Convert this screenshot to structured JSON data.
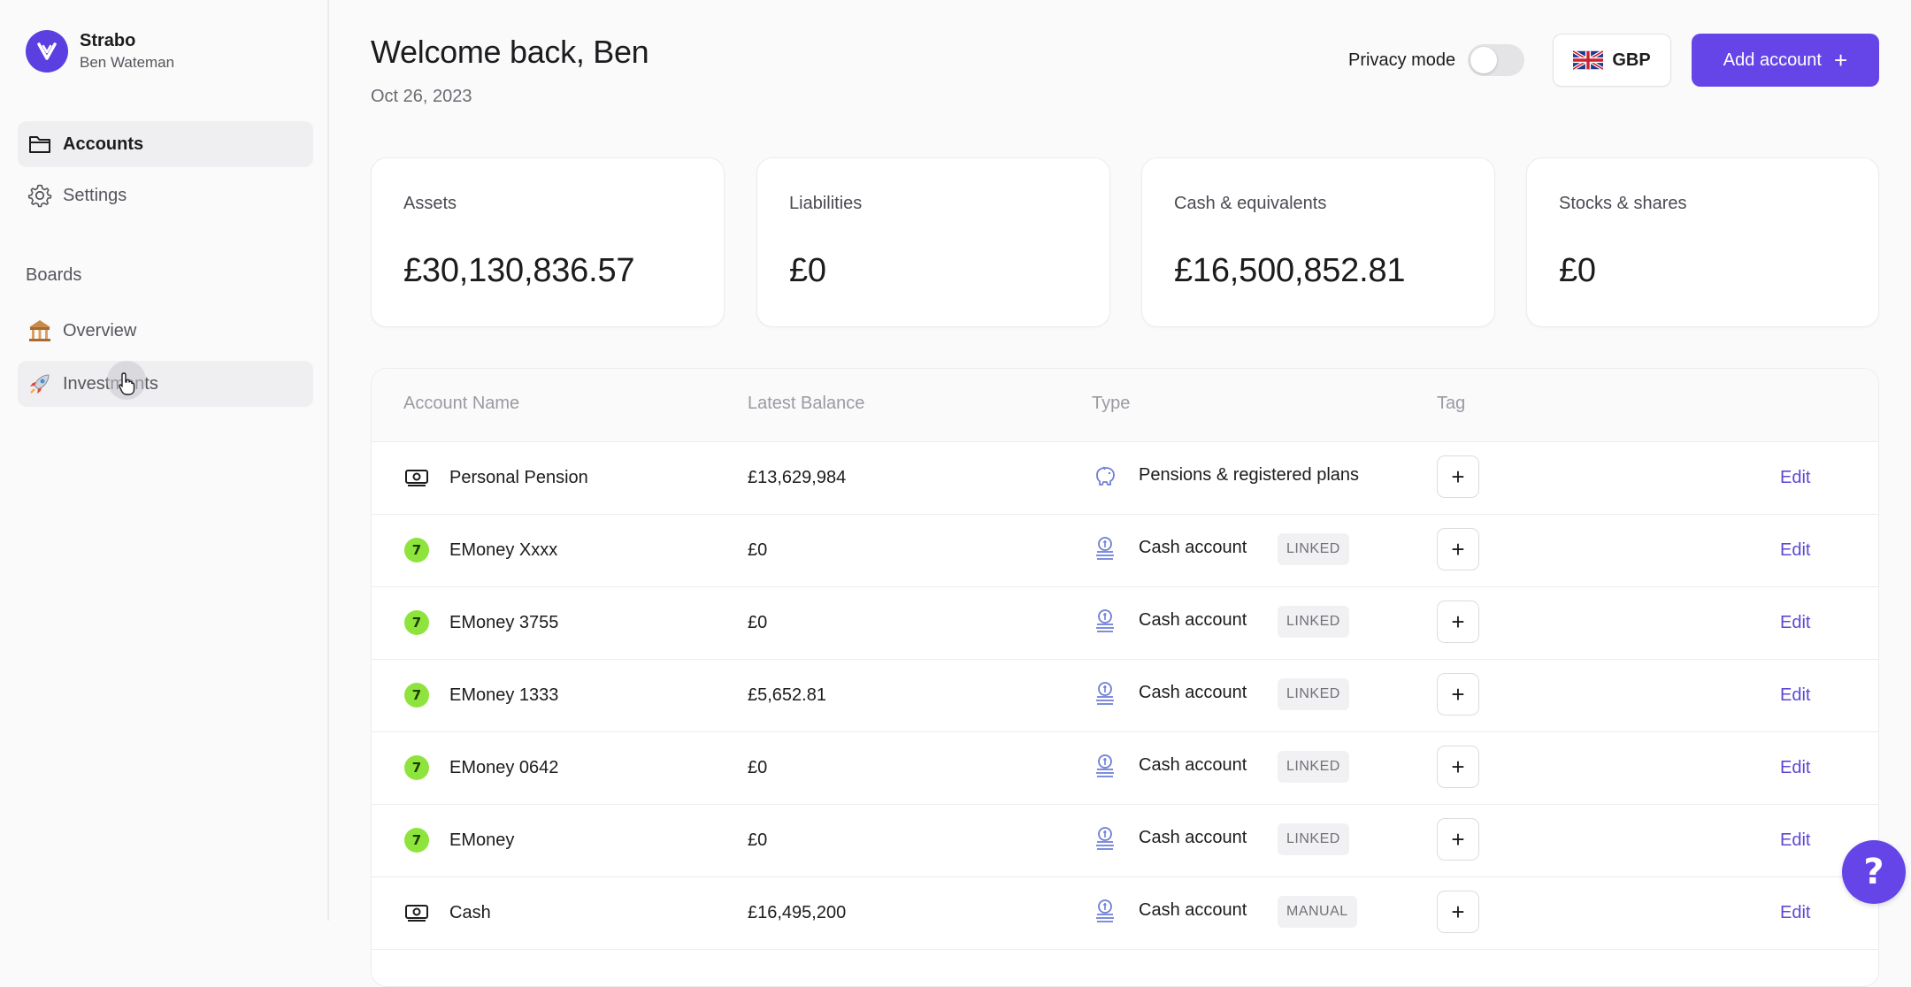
{
  "brand": {
    "name": "Strabo",
    "user": "Ben Wateman"
  },
  "sidebar": {
    "items": [
      {
        "label": "Accounts",
        "icon": "folder-icon"
      },
      {
        "label": "Settings",
        "icon": "gear-icon"
      }
    ],
    "boards_label": "Boards",
    "boards": [
      {
        "label": "Overview",
        "icon": "bank-emoji-icon"
      },
      {
        "label": "Investments",
        "icon": "rocket-emoji-icon"
      }
    ]
  },
  "header": {
    "title": "Welcome back, Ben",
    "date": "Oct 26, 2023",
    "privacy_label": "Privacy mode",
    "privacy_on": false,
    "currency": "GBP",
    "add_account": "Add account"
  },
  "cards": [
    {
      "label": "Assets",
      "value": "£30,130,836.57"
    },
    {
      "label": "Liabilities",
      "value": "£0"
    },
    {
      "label": "Cash & equivalents",
      "value": "£16,500,852.81"
    },
    {
      "label": "Stocks & shares",
      "value": "£0"
    }
  ],
  "table": {
    "columns": [
      "Account Name",
      "Latest Balance",
      "Type",
      "Tag"
    ],
    "edit_label": "Edit",
    "add_tag": "+",
    "rows": [
      {
        "icon": "banknote-icon",
        "name": "Personal Pension",
        "balance": "£13,629,984",
        "type_icon": "piggy-bank-icon",
        "type": "Pensions & registered plans",
        "badge": ""
      },
      {
        "icon": "emoney-logo",
        "name": "EMoney Xxxx",
        "balance": "£0",
        "type_icon": "coin-stack-icon",
        "type": "Cash account",
        "badge": "LINKED"
      },
      {
        "icon": "emoney-logo",
        "name": "EMoney 3755",
        "balance": "£0",
        "type_icon": "coin-stack-icon",
        "type": "Cash account",
        "badge": "LINKED"
      },
      {
        "icon": "emoney-logo",
        "name": "EMoney 1333",
        "balance": "£5,652.81",
        "type_icon": "coin-stack-icon",
        "type": "Cash account",
        "badge": "LINKED"
      },
      {
        "icon": "emoney-logo",
        "name": "EMoney 0642",
        "balance": "£0",
        "type_icon": "coin-stack-icon",
        "type": "Cash account",
        "badge": "LINKED"
      },
      {
        "icon": "emoney-logo",
        "name": "EMoney",
        "balance": "£0",
        "type_icon": "coin-stack-icon",
        "type": "Cash account",
        "badge": "LINKED"
      },
      {
        "icon": "banknote-icon",
        "name": "Cash",
        "balance": "£16,495,200",
        "type_icon": "coin-stack-icon",
        "type": "Cash account",
        "badge": "MANUAL"
      }
    ]
  },
  "help": {
    "label": "?"
  },
  "colors": {
    "accent": "#6545e8",
    "link": "#5b48d6",
    "emoney": "#8ee43d"
  }
}
